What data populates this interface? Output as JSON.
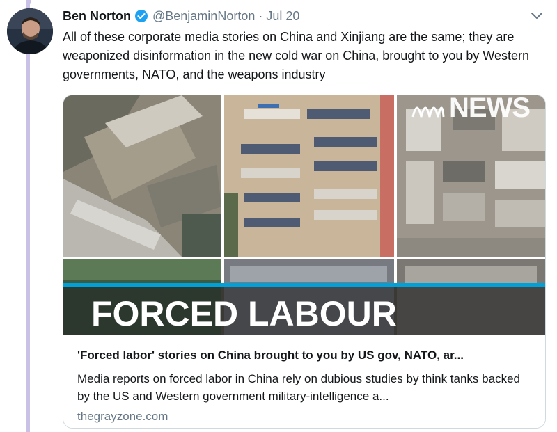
{
  "tweet": {
    "author_name": "Ben Norton",
    "handle": "@BenjaminNorton",
    "separator": "·",
    "date": "Jul 20",
    "text": "All of these corporate media stories on China and Xinjiang are the same; they are weaponized disinformation in the new cold war on China, brought to you by Western governments, NATO, and the weapons industry"
  },
  "card": {
    "image_overlay": {
      "brand": "NEWS",
      "headline": "FORCED LABOUR"
    },
    "title": "'Forced labor' stories on China brought to you by US gov, NATO, ar...",
    "description": "Media reports on forced labor in China rely on dubious studies by think tanks backed by the US and Western government military-intelligence a...",
    "domain": "thegrayzone.com"
  },
  "icons": {
    "verified": "verified-badge-icon",
    "menu": "chevron-down-icon"
  },
  "colors": {
    "thread_line": "#c9c2e6",
    "verified": "#1da1f2",
    "secondary_text": "#657786",
    "banner_accent": "#00a1d9"
  }
}
